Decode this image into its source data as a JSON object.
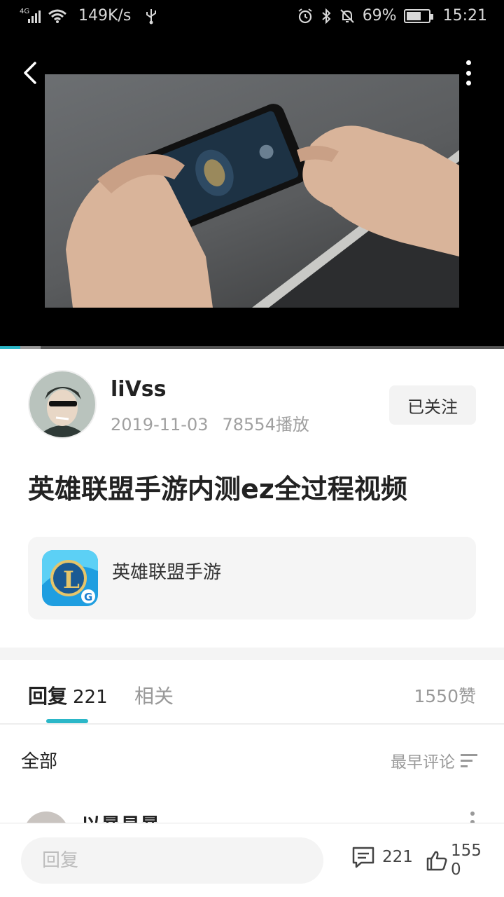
{
  "status_bar": {
    "network_type": "4G",
    "speed": "149K/s",
    "battery": "69%",
    "battery_level": 0.69,
    "time": "15:21"
  },
  "video": {
    "progress": 0.04,
    "buffered": 0.08
  },
  "author": {
    "name": "liVss",
    "date": "2019-11-03",
    "plays": "78554播放",
    "follow_label": "已关注"
  },
  "title": "英雄联盟手游内测ez全过程视频",
  "game_card": {
    "name": "英雄联盟手游"
  },
  "tabs": {
    "reply_label": "回复",
    "reply_count": "221",
    "related_label": "相关",
    "likes_total": "1550赞"
  },
  "filter": {
    "all_label": "全部",
    "sort_label": "最早评论"
  },
  "comment_preview": {
    "author": "以暴易暴"
  },
  "bottom_bar": {
    "reply_placeholder": "回复",
    "comment_count": "221",
    "like_count": "1550"
  },
  "colors": {
    "accent": "#2bb7c8",
    "status_bar_bg": "#000000"
  }
}
